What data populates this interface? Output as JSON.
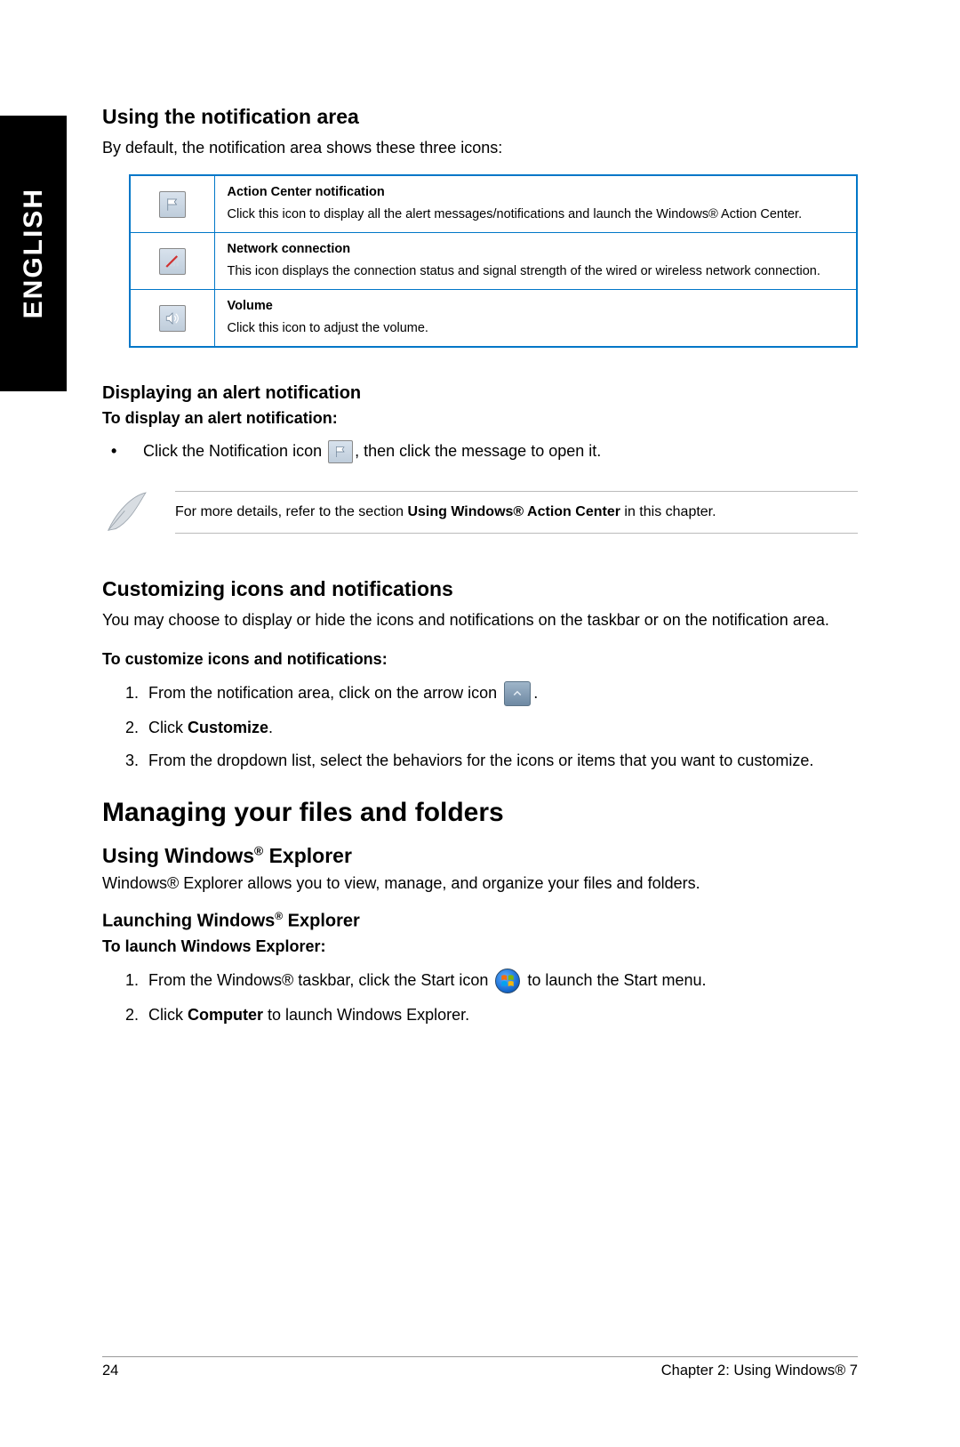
{
  "lang_tab": "ENGLISH",
  "s1": {
    "heading": "Using the notification area",
    "intro": "By default, the notification area shows these three icons:",
    "rows": [
      {
        "title": "Action Center notification",
        "desc": "Click this icon to display all the alert messages/notifications and launch the Windows® Action Center."
      },
      {
        "title": "Network connection",
        "desc": "This icon displays the connection status and signal strength of the wired or wireless network connection."
      },
      {
        "title": "Volume",
        "desc": "Click this icon to adjust the volume."
      }
    ]
  },
  "s2": {
    "heading": "Displaying an alert notification",
    "boldline": "To display an alert notification:",
    "bullet_pre": "Click the Notification icon ",
    "bullet_post": ", then click the message to open it."
  },
  "note": {
    "pre": "For more details, refer to the section ",
    "bold": "Using Windows® Action Center",
    "post": " in this chapter."
  },
  "s3": {
    "heading": "Customizing icons and notifications",
    "intro": "You may choose to display or hide the icons and notifications on the taskbar or on the notification area.",
    "boldline": "To customize icons and notifications:",
    "steps": {
      "s1a": "From the notification area, click on the arrow icon ",
      "s1b": ".",
      "s2a": "Click ",
      "s2b": "Customize",
      "s2c": ".",
      "s3": "From the dropdown list, select the behaviors for the icons or items that you want to customize."
    }
  },
  "major": "Managing your files and folders",
  "s4": {
    "heading": "Using Windows® Explorer",
    "intro": "Windows® Explorer allows you to view, manage, and organize your files and folders.",
    "subhead": "Launching Windows® Explorer",
    "boldline": "To launch Windows Explorer:",
    "steps": {
      "s1a": "From the Windows® taskbar, click the Start icon ",
      "s1b": " to launch the Start menu.",
      "s2a": "Click ",
      "s2b": "Computer",
      "s2c": " to launch Windows Explorer."
    }
  },
  "footer": {
    "page": "24",
    "chapter": "Chapter 2: Using Windows® 7"
  }
}
